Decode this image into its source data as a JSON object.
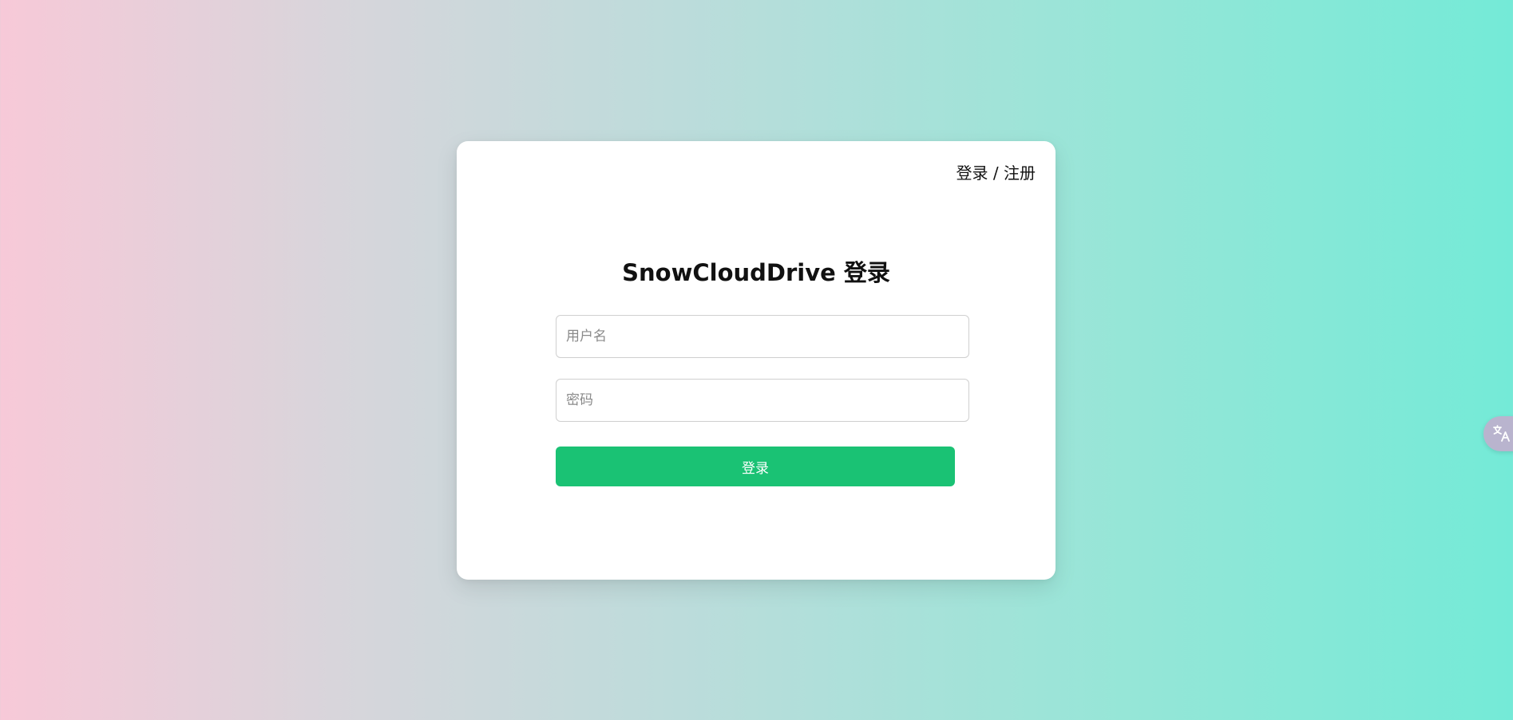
{
  "card": {
    "toggle_link": "登录 / 注册",
    "title": "SnowCloudDrive 登录",
    "username": {
      "placeholder": "用户名",
      "value": ""
    },
    "password": {
      "placeholder": "密码",
      "value": ""
    },
    "submit_label": "登录"
  },
  "floating_button": {
    "icon": "translate-icon"
  },
  "colors": {
    "primary_button": "#1ac274",
    "background_left": "#f7c9d8",
    "background_right": "#74ead7"
  }
}
